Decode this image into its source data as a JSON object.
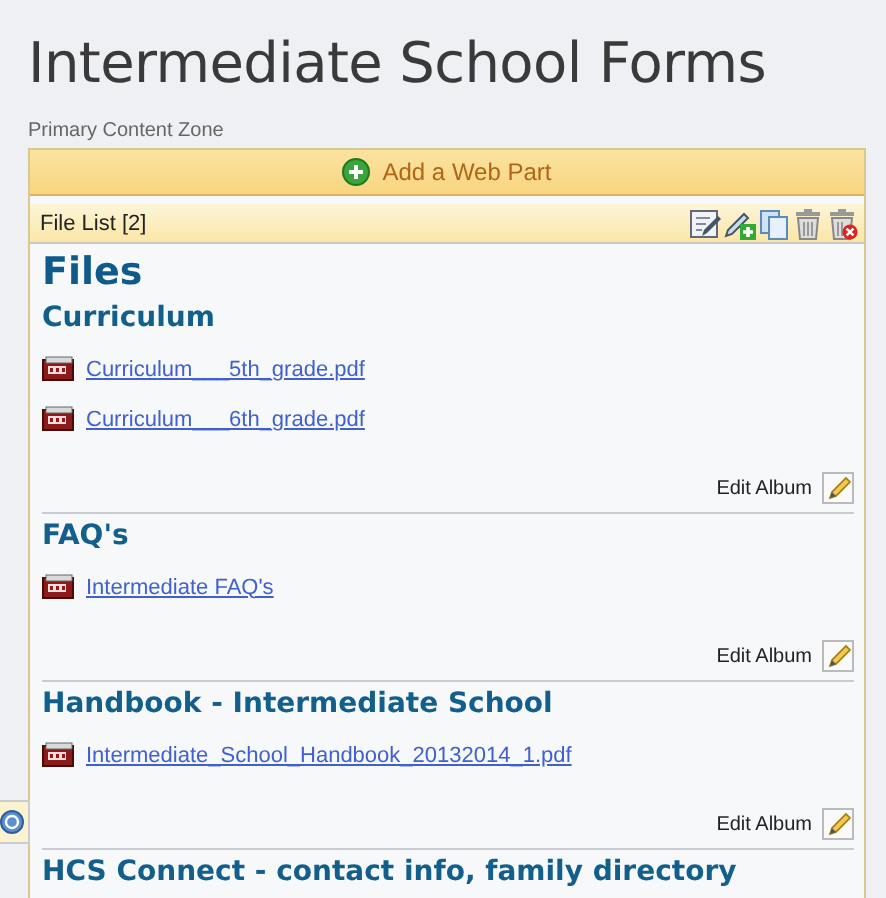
{
  "page": {
    "title": "Intermediate School Forms"
  },
  "zone": {
    "label": "Primary Content Zone",
    "add_button": "Add a Web Part"
  },
  "webpart": {
    "title": "File List [2]",
    "heading": "Files",
    "albums": [
      {
        "title": "Curriculum",
        "files": [
          "Curriculum___5th_grade.pdf",
          "Curriculum___6th_grade.pdf"
        ],
        "edit_label": "Edit Album"
      },
      {
        "title": "FAQ's",
        "files": [
          "Intermediate FAQ's"
        ],
        "edit_label": "Edit Album"
      },
      {
        "title": "Handbook - Intermediate School",
        "files": [
          "Intermediate_School_Handbook_20132014_1.pdf"
        ],
        "edit_label": "Edit Album"
      },
      {
        "title": "HCS Connect - contact info, family directory"
      }
    ]
  }
}
